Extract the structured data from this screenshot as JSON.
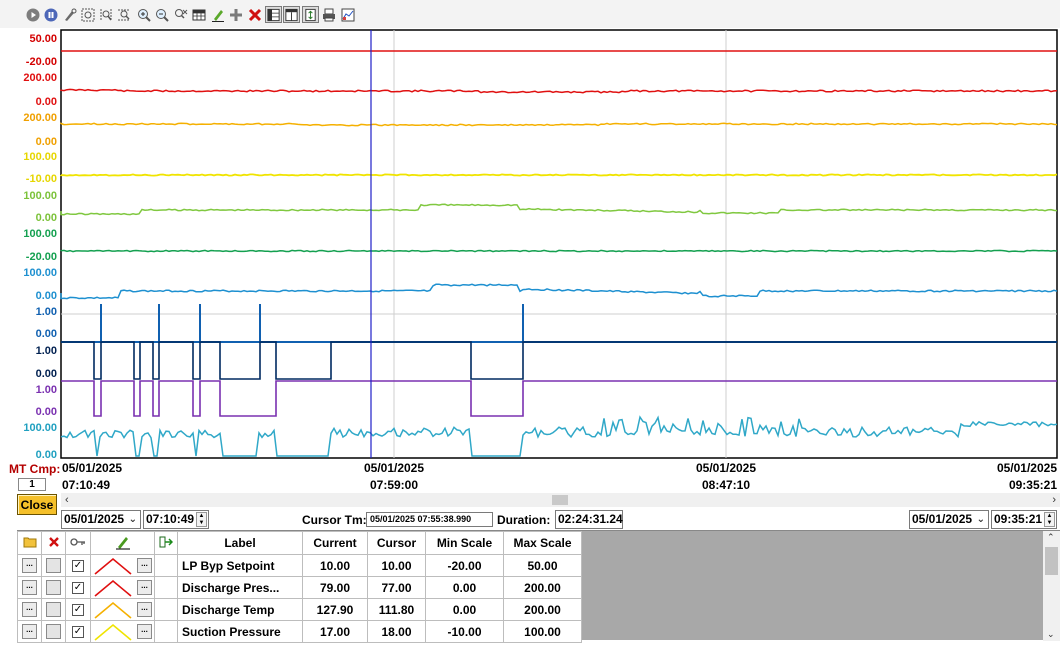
{
  "toolbar": {
    "icons": [
      "play-icon",
      "pause-icon",
      "edit-link-icon",
      "zoom-region-icon",
      "zoom-vertical-icon",
      "zoom-horizontal-icon",
      "zoom-in-icon",
      "zoom-out-icon",
      "zoom-reset-icon",
      "table-icon",
      "pen-icon",
      "add-icon",
      "delete-icon",
      "stacked-view-icon",
      "single-view-icon",
      "vertical-fit-icon",
      "print-icon",
      "export-icon"
    ]
  },
  "chart": {
    "scale_labels": [
      {
        "text": "50.00",
        "color": "#d40000"
      },
      {
        "text": "-20.00",
        "color": "#d40000"
      },
      {
        "text": "200.00",
        "color": "#e01010"
      },
      {
        "text": "0.00",
        "color": "#e01010"
      },
      {
        "text": "200.00",
        "color": "#f0a000"
      },
      {
        "text": "0.00",
        "color": "#f0a000"
      },
      {
        "text": "100.00",
        "color": "#e6d600"
      },
      {
        "text": "-10.00",
        "color": "#e6d600"
      },
      {
        "text": "100.00",
        "color": "#7cc23a"
      },
      {
        "text": "0.00",
        "color": "#7cc23a"
      },
      {
        "text": "100.00",
        "color": "#14a050"
      },
      {
        "text": "-20.00",
        "color": "#14a050"
      },
      {
        "text": "100.00",
        "color": "#1e90d0"
      },
      {
        "text": "0.00",
        "color": "#1e90d0"
      },
      {
        "text": "1.00",
        "color": "#1060b0"
      },
      {
        "text": "0.00",
        "color": "#1060b0"
      },
      {
        "text": "1.00",
        "color": "#002050"
      },
      {
        "text": "0.00",
        "color": "#002050"
      },
      {
        "text": "1.00",
        "color": "#7a30b0"
      },
      {
        "text": "0.00",
        "color": "#7a30b0"
      },
      {
        "text": "100.00",
        "color": "#20a0c0"
      },
      {
        "text": "0.00",
        "color": "#20a0c0"
      }
    ],
    "time_ticks": [
      {
        "date": "05/01/2025",
        "time": "07:10:49"
      },
      {
        "date": "05/01/2025",
        "time": "07:59:00"
      },
      {
        "date": "05/01/2025",
        "time": "08:47:10"
      },
      {
        "date": "05/01/2025",
        "time": "09:35:21"
      }
    ],
    "colors": {
      "lp_byp_setpoint": "#e01010",
      "discharge_pres": "#e01010",
      "discharge_temp": "#f5b000",
      "suction_pressure": "#f0e400",
      "green_light": "#80c840",
      "green_dark": "#14a050",
      "blue": "#1e90d0",
      "digital_blue": "#1060b0",
      "digital_navy": "#002a60",
      "digital_purple": "#7a30b0",
      "cyan": "#30a8c8",
      "cursor": "#2020c8"
    }
  },
  "controls": {
    "mt_cmp_label": "MT Cmp:",
    "mt_cmp_value": "1",
    "close_label": "Close",
    "start_date": "05/01/2025",
    "start_time": "07:10:49",
    "cursor_label": "Cursor Tm:",
    "cursor_value": "05/01/2025 07:55:38.990",
    "duration_label": "Duration:",
    "duration_value": "02:24:31.24",
    "end_date": "05/01/2025",
    "end_time": "09:35:21"
  },
  "table": {
    "headers": {
      "label": "Label",
      "current": "Current",
      "cursor": "Cursor",
      "min_scale": "Min Scale",
      "max_scale": "Max Scale"
    },
    "header_icons": [
      "folder-icon",
      "delete-icon",
      "key-icon",
      "pen-icon",
      "export-icon"
    ],
    "rows": [
      {
        "label": "LP Byp Setpoint",
        "current": "10.00",
        "cursor": "10.00",
        "min": "-20.00",
        "max": "50.00",
        "color": "#e01010"
      },
      {
        "label": "Discharge Pres...",
        "current": "79.00",
        "cursor": "77.00",
        "min": "0.00",
        "max": "200.00",
        "color": "#e01010"
      },
      {
        "label": "Discharge Temp",
        "current": "127.90",
        "cursor": "111.80",
        "min": "0.00",
        "max": "200.00",
        "color": "#f5b000"
      },
      {
        "label": "Suction Pressure",
        "current": "17.00",
        "cursor": "18.00",
        "min": "-10.00",
        "max": "100.00",
        "color": "#f0e400"
      }
    ]
  }
}
